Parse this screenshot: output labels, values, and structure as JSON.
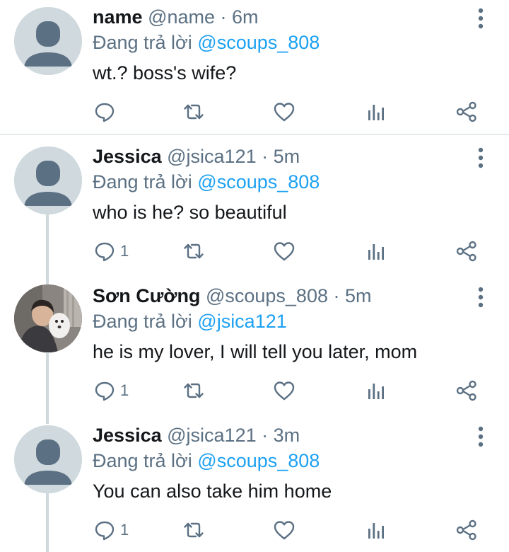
{
  "colors": {
    "accent": "#1da1f2",
    "muted": "#5b7083",
    "avatar_placeholder": "#cfd9de",
    "avatar_figure": "#5b7083"
  },
  "icons": {
    "more": "three-dots-vertical",
    "reply": "speech-bubble",
    "retweet": "retweet-arrows",
    "like": "heart",
    "stats": "bar-chart",
    "share": "share-nodes"
  },
  "tweets": [
    {
      "name": "name",
      "handle": "@name",
      "time": "· 6m",
      "reply_prefix": "Đang trả lời",
      "reply_handle": "@scoups_808",
      "text": "wt.? boss's wife?",
      "reply_count": ""
    },
    {
      "name": "Jessica",
      "handle": "@jsica121",
      "time": "· 5m",
      "reply_prefix": "Đang trả lời",
      "reply_handle": "@scoups_808",
      "text": "who is he? so beautiful",
      "reply_count": "1"
    },
    {
      "name": "Sơn Cường",
      "handle": "@scoups_808",
      "time": "· 5m",
      "reply_prefix": "Đang trả lời",
      "reply_handle": "@jsica121",
      "text": "he is my lover, I will tell you later, mom",
      "reply_count": "1"
    },
    {
      "name": "Jessica",
      "handle": "@jsica121",
      "time": "· 3m",
      "reply_prefix": "Đang trả lời",
      "reply_handle": "@scoups_808",
      "text": "You can also take him home",
      "reply_count": "1"
    }
  ]
}
